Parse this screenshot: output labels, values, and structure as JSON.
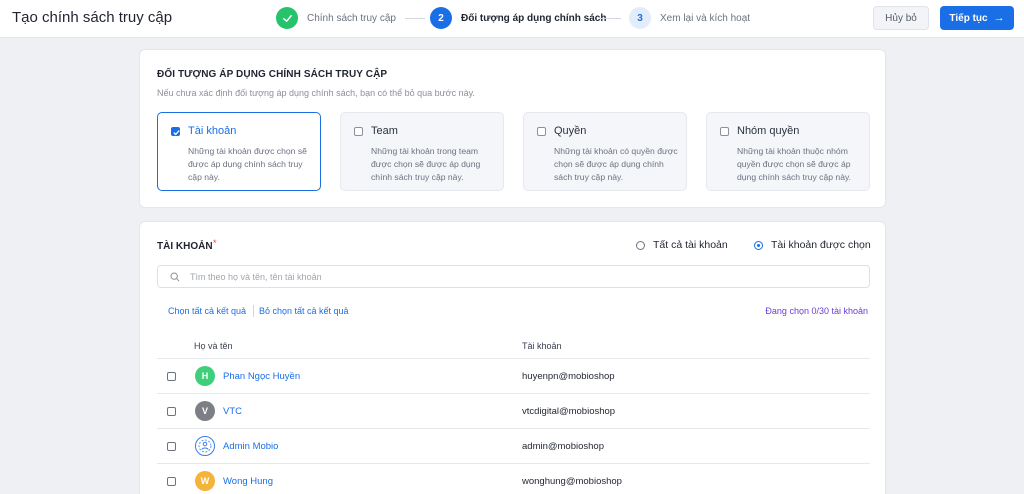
{
  "header": {
    "title": "Tạo chính sách truy cập",
    "steps": [
      {
        "number": "",
        "label": "Chính sách truy cập",
        "state": "done"
      },
      {
        "number": "2",
        "label": "Đối tượng áp dụng chính sách",
        "state": "active"
      },
      {
        "number": "3",
        "label": "Xem lại và kích hoạt",
        "state": "pending"
      }
    ],
    "cancel_label": "Hủy bỏ",
    "next_label": "Tiếp tục",
    "next_icon": "arrow-right-icon"
  },
  "target_section": {
    "title": "ĐỐI TƯỢNG ÁP DỤNG CHÍNH SÁCH TRUY CẬP",
    "hint": "Nếu chưa xác định đối tượng áp dụng chính sách, bạn có thể bỏ qua bước này.",
    "options": [
      {
        "title": "Tài khoản",
        "desc": "Những tài khoản được chọn sẽ được áp dụng chính sách truy cập này.",
        "checked": true
      },
      {
        "title": "Team",
        "desc": "Những tài khoản trong team được chọn sẽ được áp dụng chính sách truy cập này.",
        "checked": false
      },
      {
        "title": "Quyền",
        "desc": "Những tài khoản có quyền được chọn sẽ được áp dụng chính sách truy cập này.",
        "checked": false
      },
      {
        "title": "Nhóm quyền",
        "desc": "Những tài khoản thuộc nhóm quyền được chọn sẽ được áp dụng chính sách truy cập này.",
        "checked": false
      }
    ]
  },
  "accounts_section": {
    "title": "TÀI KHOẢN",
    "required_mark": "*",
    "radio_all": "Tất cả tài khoản",
    "radio_selected": "Tài khoản được chọn",
    "search_placeholder": "Tìm theo họ và tên, tên tài khoản",
    "select_all": "Chọn tất cả kết quả",
    "deselect_all": "Bỏ chọn tất cả kết quả",
    "selected_count": "Đang chọn 0/30 tài khoản",
    "columns": [
      "Họ và tên",
      "Tài khoản"
    ],
    "rows": [
      {
        "avatar": "H",
        "avatar_color": "#3fcf7a",
        "name": "Phan Ngọc Huyền",
        "account": "huyenpn@mobioshop"
      },
      {
        "avatar": "V",
        "avatar_color": "#7d7f86",
        "name": "VTC",
        "account": "vtcdigital@mobioshop"
      },
      {
        "avatar": "",
        "avatar_color": "#3b7fe8",
        "name": "Admin Mobio",
        "account": "admin@mobioshop"
      },
      {
        "avatar": "W",
        "avatar_color": "#f4b43a",
        "name": "Wong Hung",
        "account": "wonghung@mobioshop"
      }
    ]
  },
  "colors": {
    "primary": "#1a6fe6",
    "success": "#27c26c",
    "count": "#6a3fd6"
  }
}
